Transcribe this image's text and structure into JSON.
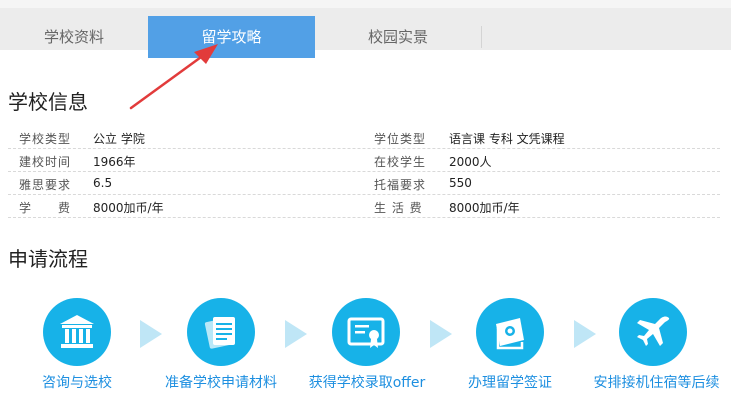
{
  "tabs": [
    {
      "label": "学校资料",
      "active": false
    },
    {
      "label": "留学攻略",
      "active": true
    },
    {
      "label": "校园实景",
      "active": false
    }
  ],
  "school_info": {
    "title": "学校信息",
    "rows": [
      {
        "label1": "学校类型",
        "value1": "公立 学院",
        "label2": "学位类型",
        "value2": "语言课 专科 文凭课程"
      },
      {
        "label1": "建校时间",
        "value1": "1966年",
        "label2": "在校学生",
        "value2": "2000人"
      },
      {
        "label1": "雅思要求",
        "value1": "6.5",
        "label2": "托福要求",
        "value2": "550"
      },
      {
        "label1": "学　　费",
        "value1": "8000加币/年",
        "label2": "生 活 费",
        "value2": "8000加币/年"
      }
    ]
  },
  "process": {
    "title": "申请流程",
    "steps": [
      {
        "label": "咨询与选校",
        "icon": "building-icon"
      },
      {
        "label": "准备学校申请材料",
        "icon": "documents-icon"
      },
      {
        "label": "获得学校录取offer",
        "icon": "certificate-icon"
      },
      {
        "label": "办理留学签证",
        "icon": "passport-icon"
      },
      {
        "label": "安排接机住宿等后续",
        "icon": "airplane-icon"
      }
    ]
  },
  "colors": {
    "active_tab": "#52a0e6",
    "arrow": "#e23b3b",
    "step_circle": "#17b2e8",
    "step_label": "#1d8fe0",
    "chevron": "#bfe6f6"
  }
}
